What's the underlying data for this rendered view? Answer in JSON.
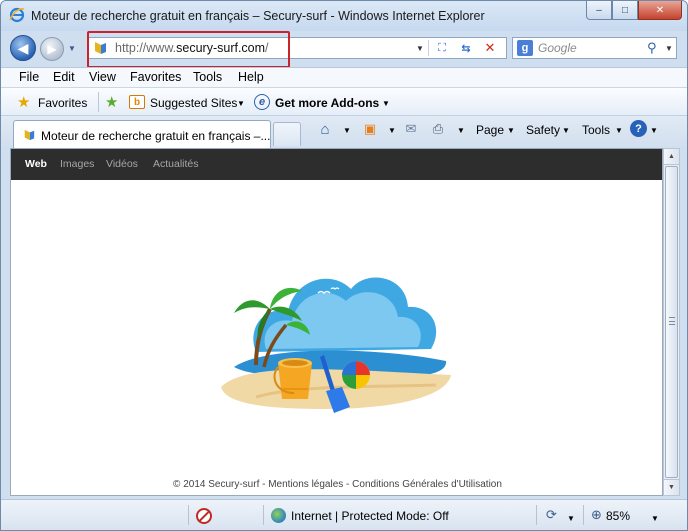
{
  "window": {
    "title": "Moteur de recherche gratuit en français – Secury-surf - Windows Internet Explorer",
    "caption_min": "–",
    "caption_max": "□",
    "caption_close": "✕"
  },
  "address": {
    "url_prefix": "http://www.",
    "url_domain": "secury-surf.com",
    "url_suffix": "/"
  },
  "search": {
    "placeholder": "Google",
    "provider_glyph": "g"
  },
  "menu": [
    "File",
    "Edit",
    "View",
    "Favorites",
    "Tools",
    "Help"
  ],
  "favorites_bar": {
    "favorites": "Favorites",
    "suggested_sites": "Suggested Sites",
    "get_addons": "Get more Add-ons"
  },
  "tab": {
    "label": "Moteur de recherche gratuit en français –..."
  },
  "command_bar": {
    "page": "Page",
    "safety": "Safety",
    "tools": "Tools"
  },
  "site": {
    "nav": {
      "web": "Web",
      "images": "Images",
      "videos": "Vidéos",
      "news": "Actualités"
    },
    "footer": "© 2014 Secury-surf - Mentions légales - Conditions Générales d'Utilisation"
  },
  "status": {
    "zone": "Internet | Protected Mode: Off",
    "zoom": "85%"
  },
  "colors": {
    "highlight": "#c9242b",
    "site_nav_bg": "#2d2d2d",
    "sea": "#3a9fde"
  }
}
